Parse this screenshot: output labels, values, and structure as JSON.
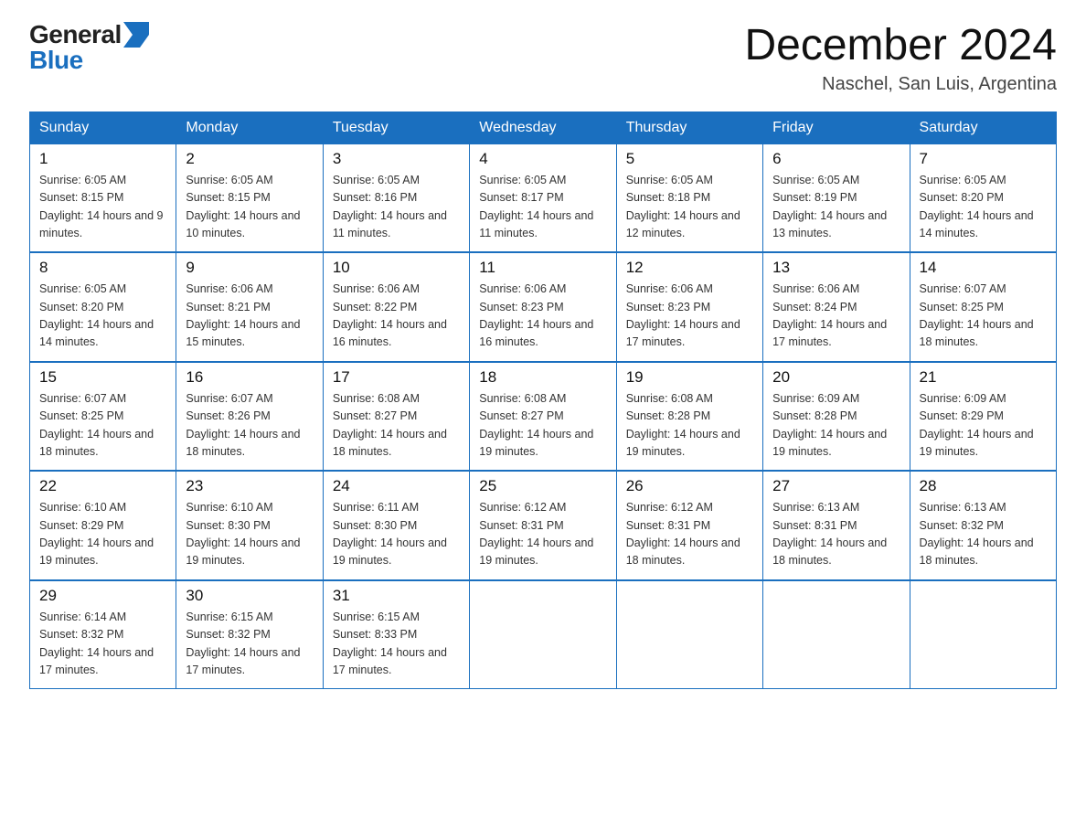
{
  "header": {
    "logo_general": "General",
    "logo_blue": "Blue",
    "title": "December 2024",
    "subtitle": "Naschel, San Luis, Argentina"
  },
  "weekdays": [
    "Sunday",
    "Monday",
    "Tuesday",
    "Wednesday",
    "Thursday",
    "Friday",
    "Saturday"
  ],
  "weeks": [
    [
      {
        "day": "1",
        "sunrise": "6:05 AM",
        "sunset": "8:15 PM",
        "daylight": "14 hours and 9 minutes."
      },
      {
        "day": "2",
        "sunrise": "6:05 AM",
        "sunset": "8:15 PM",
        "daylight": "14 hours and 10 minutes."
      },
      {
        "day": "3",
        "sunrise": "6:05 AM",
        "sunset": "8:16 PM",
        "daylight": "14 hours and 11 minutes."
      },
      {
        "day": "4",
        "sunrise": "6:05 AM",
        "sunset": "8:17 PM",
        "daylight": "14 hours and 11 minutes."
      },
      {
        "day": "5",
        "sunrise": "6:05 AM",
        "sunset": "8:18 PM",
        "daylight": "14 hours and 12 minutes."
      },
      {
        "day": "6",
        "sunrise": "6:05 AM",
        "sunset": "8:19 PM",
        "daylight": "14 hours and 13 minutes."
      },
      {
        "day": "7",
        "sunrise": "6:05 AM",
        "sunset": "8:20 PM",
        "daylight": "14 hours and 14 minutes."
      }
    ],
    [
      {
        "day": "8",
        "sunrise": "6:05 AM",
        "sunset": "8:20 PM",
        "daylight": "14 hours and 14 minutes."
      },
      {
        "day": "9",
        "sunrise": "6:06 AM",
        "sunset": "8:21 PM",
        "daylight": "14 hours and 15 minutes."
      },
      {
        "day": "10",
        "sunrise": "6:06 AM",
        "sunset": "8:22 PM",
        "daylight": "14 hours and 16 minutes."
      },
      {
        "day": "11",
        "sunrise": "6:06 AM",
        "sunset": "8:23 PM",
        "daylight": "14 hours and 16 minutes."
      },
      {
        "day": "12",
        "sunrise": "6:06 AM",
        "sunset": "8:23 PM",
        "daylight": "14 hours and 17 minutes."
      },
      {
        "day": "13",
        "sunrise": "6:06 AM",
        "sunset": "8:24 PM",
        "daylight": "14 hours and 17 minutes."
      },
      {
        "day": "14",
        "sunrise": "6:07 AM",
        "sunset": "8:25 PM",
        "daylight": "14 hours and 18 minutes."
      }
    ],
    [
      {
        "day": "15",
        "sunrise": "6:07 AM",
        "sunset": "8:25 PM",
        "daylight": "14 hours and 18 minutes."
      },
      {
        "day": "16",
        "sunrise": "6:07 AM",
        "sunset": "8:26 PM",
        "daylight": "14 hours and 18 minutes."
      },
      {
        "day": "17",
        "sunrise": "6:08 AM",
        "sunset": "8:27 PM",
        "daylight": "14 hours and 18 minutes."
      },
      {
        "day": "18",
        "sunrise": "6:08 AM",
        "sunset": "8:27 PM",
        "daylight": "14 hours and 19 minutes."
      },
      {
        "day": "19",
        "sunrise": "6:08 AM",
        "sunset": "8:28 PM",
        "daylight": "14 hours and 19 minutes."
      },
      {
        "day": "20",
        "sunrise": "6:09 AM",
        "sunset": "8:28 PM",
        "daylight": "14 hours and 19 minutes."
      },
      {
        "day": "21",
        "sunrise": "6:09 AM",
        "sunset": "8:29 PM",
        "daylight": "14 hours and 19 minutes."
      }
    ],
    [
      {
        "day": "22",
        "sunrise": "6:10 AM",
        "sunset": "8:29 PM",
        "daylight": "14 hours and 19 minutes."
      },
      {
        "day": "23",
        "sunrise": "6:10 AM",
        "sunset": "8:30 PM",
        "daylight": "14 hours and 19 minutes."
      },
      {
        "day": "24",
        "sunrise": "6:11 AM",
        "sunset": "8:30 PM",
        "daylight": "14 hours and 19 minutes."
      },
      {
        "day": "25",
        "sunrise": "6:12 AM",
        "sunset": "8:31 PM",
        "daylight": "14 hours and 19 minutes."
      },
      {
        "day": "26",
        "sunrise": "6:12 AM",
        "sunset": "8:31 PM",
        "daylight": "14 hours and 18 minutes."
      },
      {
        "day": "27",
        "sunrise": "6:13 AM",
        "sunset": "8:31 PM",
        "daylight": "14 hours and 18 minutes."
      },
      {
        "day": "28",
        "sunrise": "6:13 AM",
        "sunset": "8:32 PM",
        "daylight": "14 hours and 18 minutes."
      }
    ],
    [
      {
        "day": "29",
        "sunrise": "6:14 AM",
        "sunset": "8:32 PM",
        "daylight": "14 hours and 17 minutes."
      },
      {
        "day": "30",
        "sunrise": "6:15 AM",
        "sunset": "8:32 PM",
        "daylight": "14 hours and 17 minutes."
      },
      {
        "day": "31",
        "sunrise": "6:15 AM",
        "sunset": "8:33 PM",
        "daylight": "14 hours and 17 minutes."
      },
      null,
      null,
      null,
      null
    ]
  ],
  "labels": {
    "sunrise_prefix": "Sunrise: ",
    "sunset_prefix": "Sunset: ",
    "daylight_prefix": "Daylight: "
  }
}
